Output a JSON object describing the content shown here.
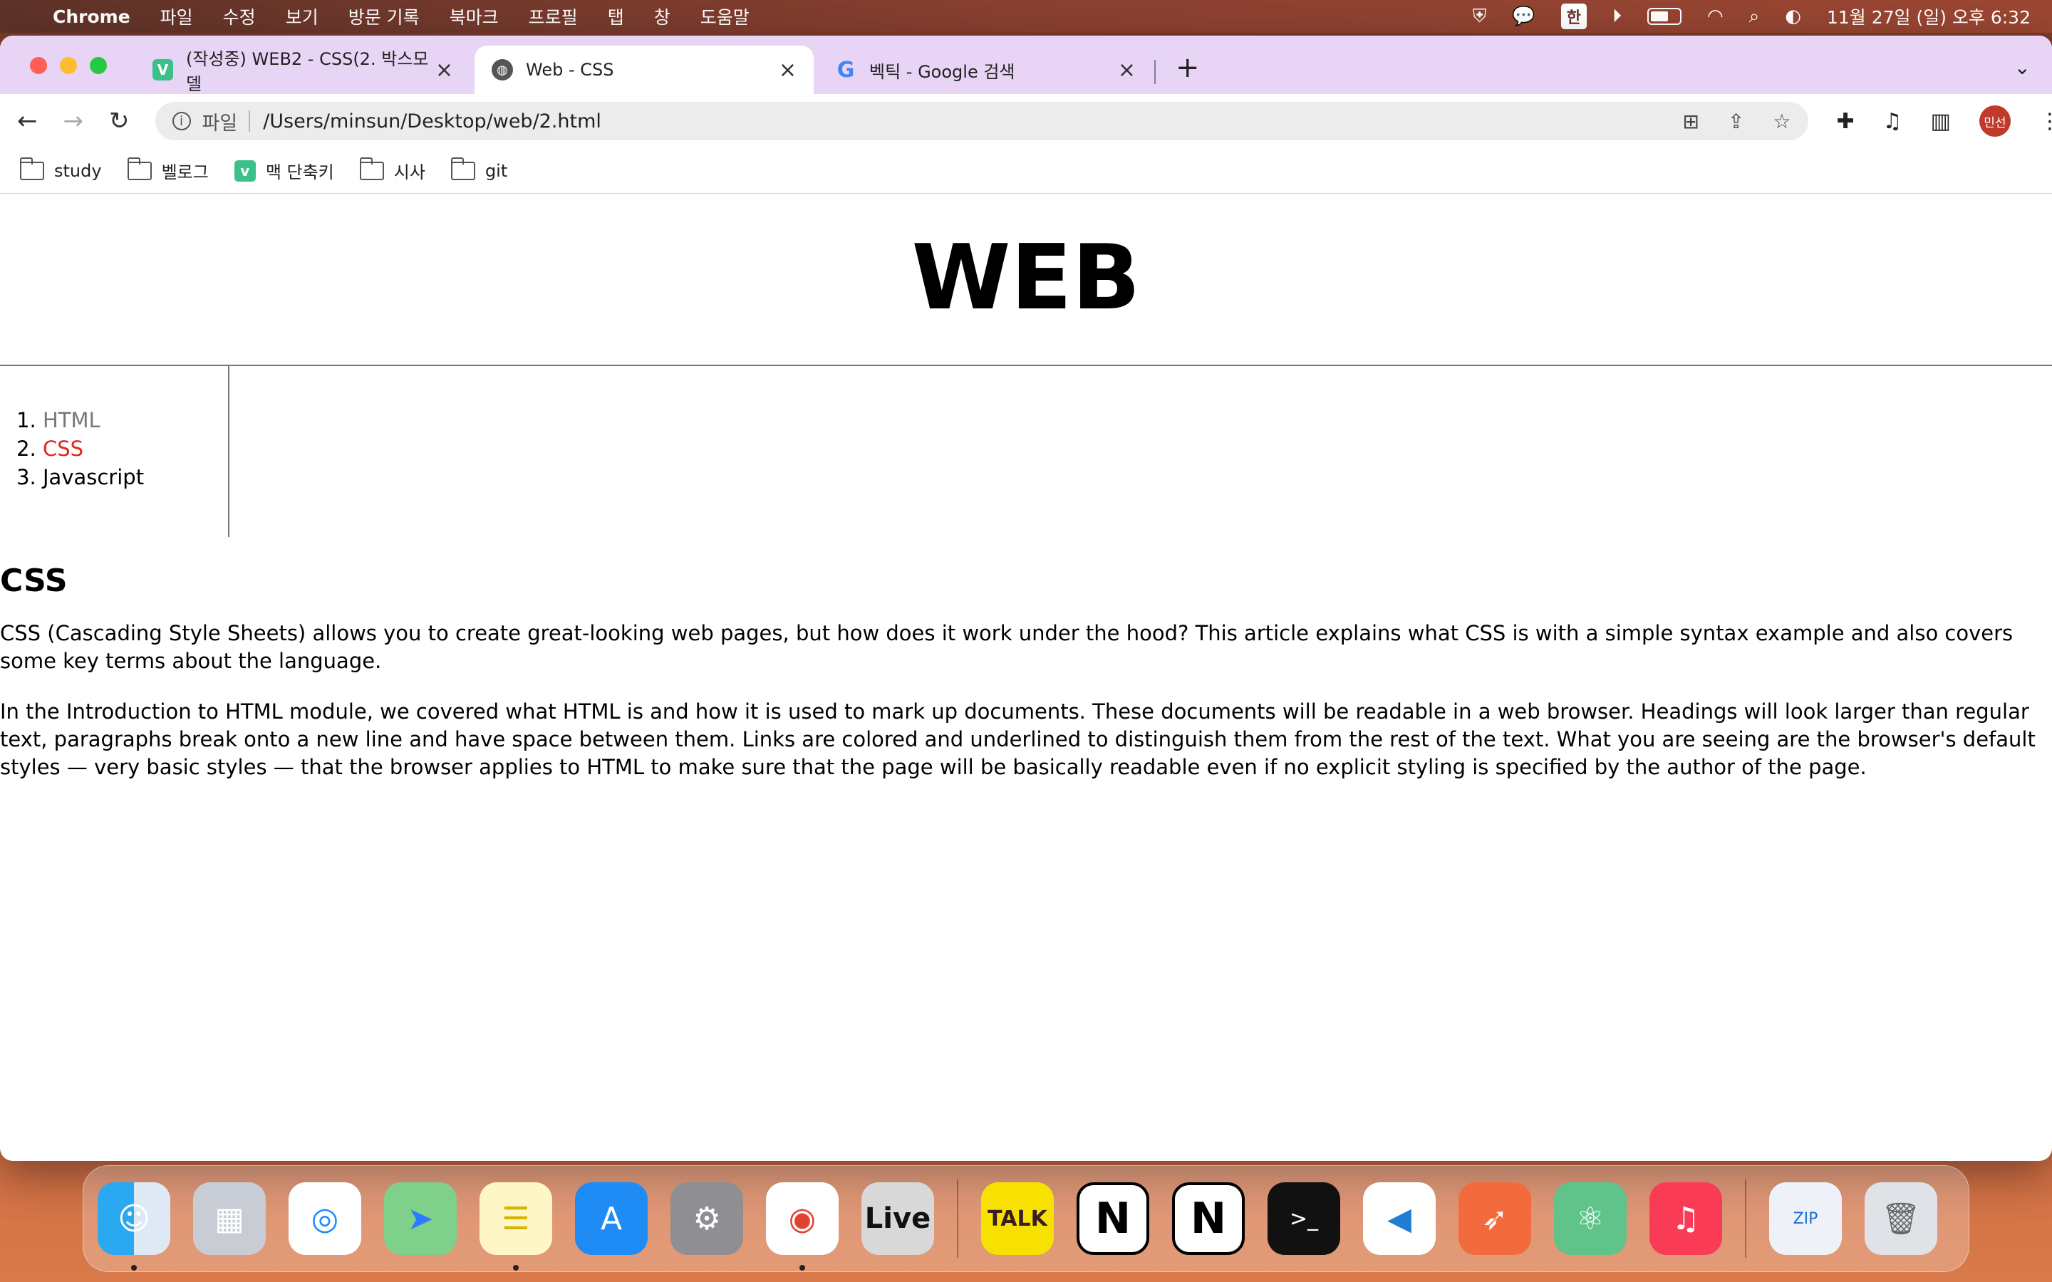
{
  "menubar": {
    "app_name": "Chrome",
    "menus": [
      "파일",
      "수정",
      "보기",
      "방문 기록",
      "북마크",
      "프로필",
      "탭",
      "창",
      "도움말"
    ],
    "ime": "한",
    "clock": "11월 27일 (일) 오후 6:32"
  },
  "tabs": [
    {
      "title": "(작성중) WEB2 - CSS(2. 박스모델",
      "favicon": "V"
    },
    {
      "title": "Web - CSS",
      "favicon": "globe"
    },
    {
      "title": "벡틱 - Google 검색",
      "favicon": "G"
    }
  ],
  "omnibox": {
    "scheme": "파일",
    "url": "/Users/minsun/Desktop/web/2.html"
  },
  "profile": {
    "initials": "민선"
  },
  "bookmarks": [
    {
      "label": "study",
      "type": "folder"
    },
    {
      "label": "벨로그",
      "type": "folder"
    },
    {
      "label": "맥 단축키",
      "type": "site"
    },
    {
      "label": "시사",
      "type": "folder"
    },
    {
      "label": "git",
      "type": "folder"
    }
  ],
  "page": {
    "heading": "WEB",
    "nav": [
      "HTML",
      "CSS",
      "Javascript"
    ],
    "article_title": "CSS",
    "paragraphs": [
      "CSS (Cascading Style Sheets) allows you to create great-looking web pages, but how does it work under the hood? This article explains what CSS is with a simple syntax example and also covers some key terms about the language.",
      "In the Introduction to HTML module, we covered what HTML is and how it is used to mark up documents. These documents will be readable in a web browser. Headings will look larger than regular text, paragraphs break onto a new line and have space between them. Links are colored and underlined to distinguish them from the rest of the text. What you are seeing are the browser's default styles — very basic styles — that the browser applies to HTML to make sure that the page will be basically readable even if no explicit styling is specified by the author of the page."
    ]
  },
  "dock": {
    "live_label": "Live",
    "kakao_label": "TALK",
    "notion_label": "N",
    "zip_label": "ZIP"
  },
  "colors": {
    "active_link": "#e0251b",
    "visited_link": "#777777",
    "tabstrip": "#e8d5f5"
  }
}
